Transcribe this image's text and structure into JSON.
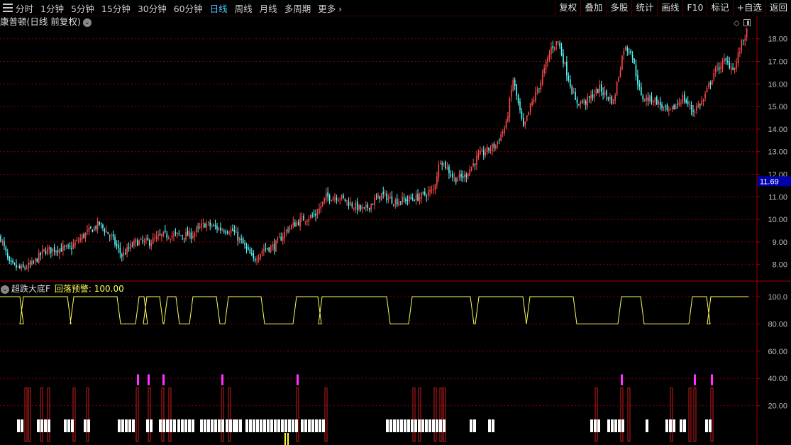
{
  "toolbar": {
    "periods": [
      "分时",
      "1分钟",
      "5分钟",
      "15分钟",
      "30分钟",
      "60分钟",
      "日线",
      "周线",
      "月线",
      "多周期",
      "更多"
    ],
    "active_period": "日线",
    "tools": [
      "复权",
      "叠加",
      "多股",
      "统计",
      "画线",
      "F10",
      "标记",
      "+自选",
      "返回"
    ]
  },
  "main_chart": {
    "title": "康普顿(日线 前复权)",
    "y_ticks": [
      "18.00",
      "17.00",
      "16.00",
      "15.00",
      "14.00",
      "13.00",
      "12.00",
      "11.00",
      "10.00",
      "9.00",
      "8.00"
    ],
    "current_price": "11.69"
  },
  "indicator": {
    "name": "超跌大底F",
    "series_label": "回落预警:",
    "series_value": "100.00",
    "y_ticks": [
      "100.0",
      "80.00",
      "60.00",
      "40.00",
      "20.00"
    ]
  },
  "colors": {
    "up": "#ff4a4a",
    "down": "#54ffff",
    "grid": "#8a0000",
    "line": "#ffff55",
    "magenta": "#ff33ff",
    "bar_red": "#cc1a1a",
    "white": "#ffffff",
    "price_box": "#0000aa"
  },
  "chart_data": [
    {
      "type": "candlestick",
      "title": "康普顿(日线 前复权)",
      "ylim": [
        7.3,
        18.4
      ],
      "y_ticks": [
        8,
        9,
        10,
        11,
        12,
        13,
        14,
        15,
        16,
        17,
        18
      ],
      "n_bars": 210,
      "close_path": [
        {
          "i": 0,
          "v": 9.2
        },
        {
          "i": 5,
          "v": 8.0
        },
        {
          "i": 12,
          "v": 7.8
        },
        {
          "i": 18,
          "v": 8.0
        },
        {
          "i": 25,
          "v": 8.6
        },
        {
          "i": 33,
          "v": 8.7
        },
        {
          "i": 40,
          "v": 8.7
        },
        {
          "i": 48,
          "v": 9.3
        },
        {
          "i": 57,
          "v": 9.8
        },
        {
          "i": 64,
          "v": 9.2
        },
        {
          "i": 70,
          "v": 8.4
        },
        {
          "i": 78,
          "v": 9.0
        },
        {
          "i": 86,
          "v": 9.0
        },
        {
          "i": 94,
          "v": 9.3
        },
        {
          "i": 102,
          "v": 9.3
        },
        {
          "i": 110,
          "v": 9.3
        },
        {
          "i": 118,
          "v": 9.8
        },
        {
          "i": 126,
          "v": 9.6
        },
        {
          "i": 134,
          "v": 9.5
        },
        {
          "i": 140,
          "v": 8.9
        },
        {
          "i": 146,
          "v": 8.2
        },
        {
          "i": 152,
          "v": 8.7
        },
        {
          "i": 158,
          "v": 8.8
        },
        {
          "i": 166,
          "v": 9.6
        },
        {
          "i": 174,
          "v": 10.0
        },
        {
          "i": 182,
          "v": 10.2
        },
        {
          "i": 188,
          "v": 11.0
        },
        {
          "i": 196,
          "v": 11.0
        },
        {
          "i": 204,
          "v": 10.6
        },
        {
          "i": 210,
          "v": 10.4
        }
      ]
    },
    {
      "type": "line",
      "name": "回落预警",
      "ylim": [
        0,
        105
      ],
      "levels": [
        100,
        80
      ],
      "low_segments": [
        [
          0,
          28,
          33
        ],
        [
          0,
          95,
          104
        ],
        [
          0,
          165,
          196
        ],
        [
          0,
          203,
          207
        ],
        [
          0,
          225,
          236
        ],
        [
          0,
          248,
          272
        ],
        [
          0,
          305,
          322
        ],
        [
          0,
          368,
          418
        ],
        [
          0,
          448,
          454
        ],
        [
          0,
          545,
          581
        ],
        [
          0,
          663,
          675
        ],
        [
          0,
          737,
          747
        ],
        [
          0,
          808,
          876
        ],
        [
          0,
          903,
          976
        ],
        [
          0,
          996,
          1002
        ]
      ]
    }
  ]
}
